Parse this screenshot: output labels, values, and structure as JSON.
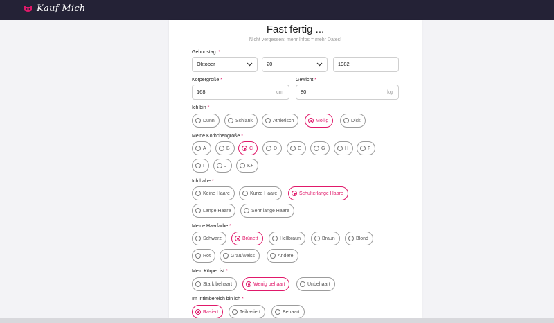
{
  "brand": {
    "name": "Kauf Mich",
    "accent_color": "#e0196a",
    "topbar_color": "#242236"
  },
  "form": {
    "title": "Fast fertig ...",
    "subtitle": "Nicht vergessen: mehr Infos = mehr Dates!",
    "birthday": {
      "label": "Geburtstag:",
      "month": "Oktober",
      "day": "20",
      "year": "1982"
    },
    "height": {
      "label": "Körpergröße",
      "value": "168",
      "unit": "cm"
    },
    "weight": {
      "label": "Gewicht",
      "value": "80",
      "unit": "kg"
    },
    "body_type": {
      "label": "Ich bin",
      "options": [
        "Dünn",
        "Schlank",
        "Athletisch",
        "Mollig",
        "Dick"
      ],
      "selected": "Mollig"
    },
    "cup_size": {
      "label": "Meine Körbchengröße",
      "options": [
        "A",
        "B",
        "C",
        "D",
        "E",
        "G",
        "H",
        "F",
        "I",
        "J",
        "K+"
      ],
      "selected": "C"
    },
    "hair_length": {
      "label": "Ich habe",
      "options": [
        "Keine Haare",
        "Kurze Haare",
        "Schulterlange Haare",
        "Lange Haare",
        "Sehr lange Haare"
      ],
      "selected": "Schulterlange Haare"
    },
    "hair_color": {
      "label": "Meine Haarfarbe",
      "options": [
        "Schwarz",
        "Brünett",
        "Hellbraun",
        "Braun",
        "Blond",
        "Rot",
        "Grau/weiss",
        "Andere"
      ],
      "selected": "Brünett"
    },
    "body_hair": {
      "label": "Mein Körper ist",
      "options": [
        "Stark behaart",
        "Wenig behaart",
        "Unbehaart"
      ],
      "selected": "Wenig behaart"
    },
    "intimate": {
      "label": "Im Intimbereich bin ich",
      "options": [
        "Rasiert",
        "Teilrasiert",
        "Behaart"
      ],
      "selected": "Rasiert"
    },
    "required_marker": "*"
  }
}
